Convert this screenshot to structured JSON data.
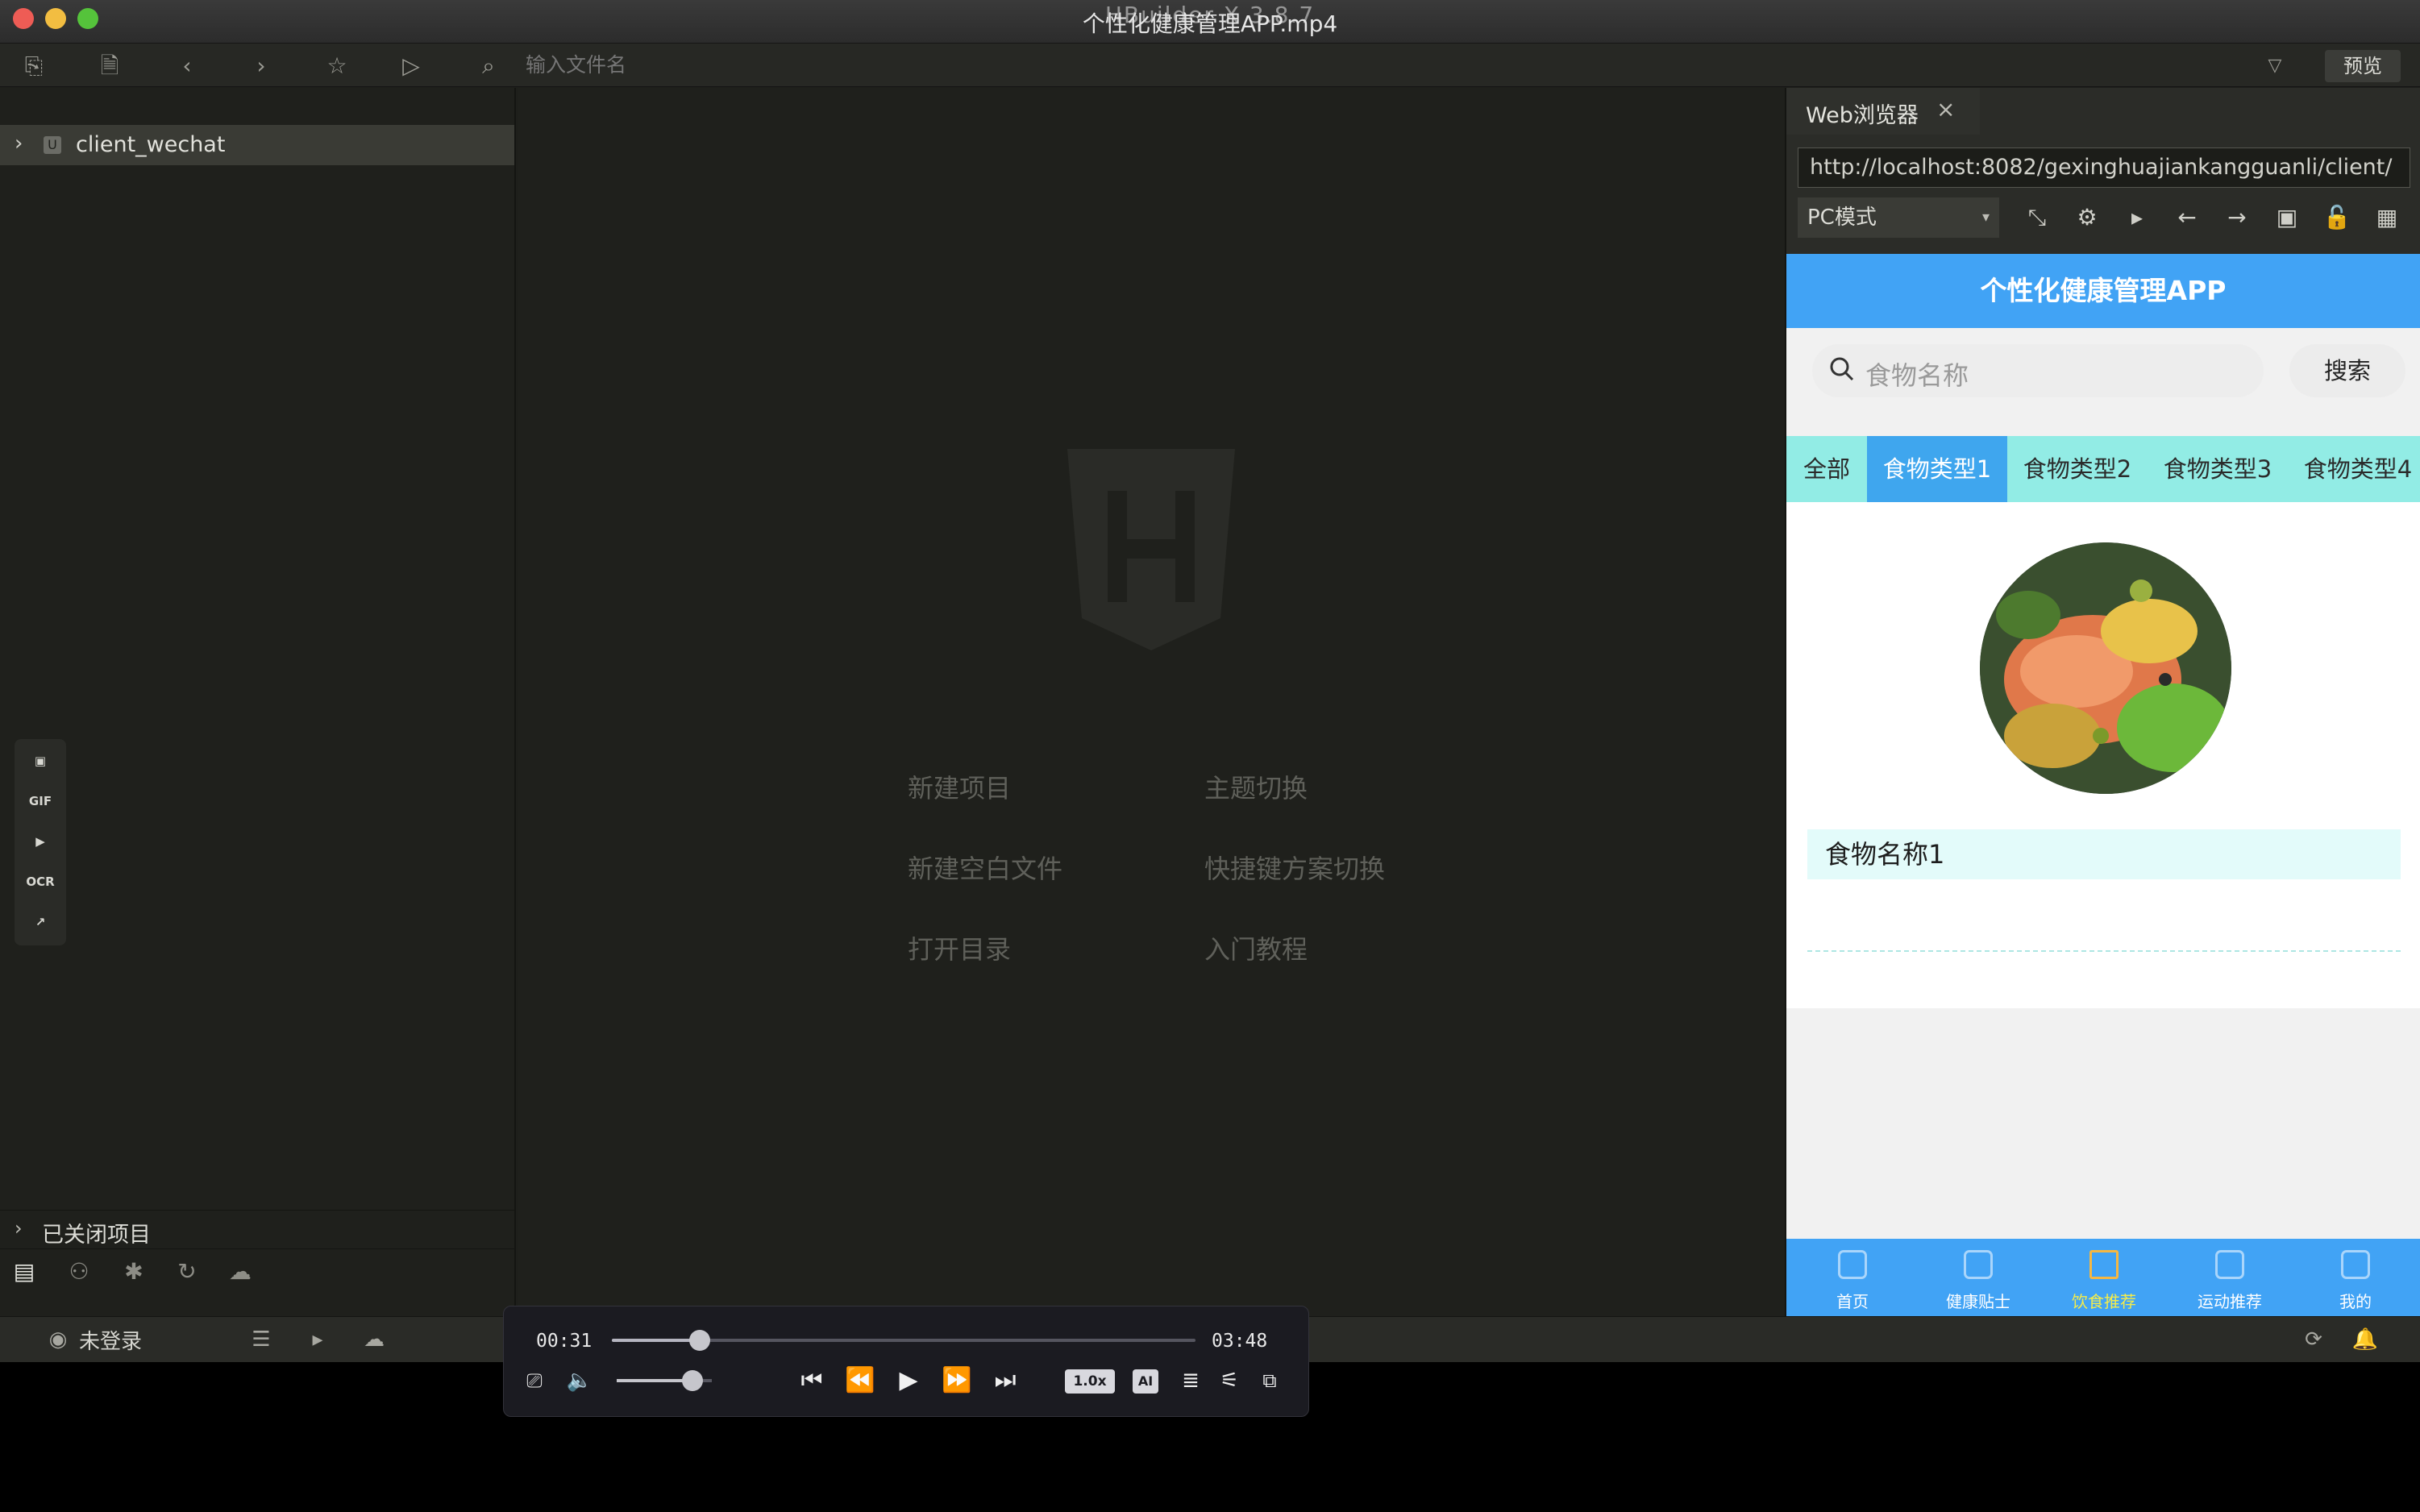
{
  "window": {
    "title": "个性化健康管理APP.mp4",
    "ghost_title": "HBuilder X 3.8.7"
  },
  "toolbar": {
    "file_placeholder": "输入文件名",
    "preview": "预览"
  },
  "sidebar": {
    "project": "client_wechat",
    "closed_projects": "已关闭项目"
  },
  "floattools": {
    "gif": "GIF",
    "ocr": "OCR"
  },
  "welcome": {
    "new_project": "新建项目",
    "theme_switch": "主题切换",
    "new_blank_file": "新建空白文件",
    "shortcut_switch": "快捷键方案切换",
    "open_dir": "打开目录",
    "tutorial": "入门教程"
  },
  "browser": {
    "tab": "Web浏览器",
    "url": "http://localhost:8082/gexinghuajiankangguanli/client/",
    "mode": "PC模式"
  },
  "app": {
    "title": "个性化健康管理APP",
    "search_placeholder": "食物名称",
    "search_button": "搜索",
    "categories": [
      "全部",
      "食物类型1",
      "食物类型2",
      "食物类型3",
      "食物类型4"
    ],
    "active_category_index": 1,
    "food_name": "食物名称1",
    "tabs": [
      "首页",
      "健康贴士",
      "饮食推荐",
      "运动推荐",
      "我的"
    ],
    "active_tab_index": 2,
    "colors": {
      "primary": "#41a3f5",
      "category_bg": "#92ece5",
      "active_tab_label": "#f5ec4a"
    }
  },
  "statusbar": {
    "user": "未登录"
  },
  "player": {
    "current": "00:31",
    "total": "03:48",
    "progress": 0.15,
    "volume": 0.8,
    "speed": "1.0x",
    "ai": "AI"
  }
}
